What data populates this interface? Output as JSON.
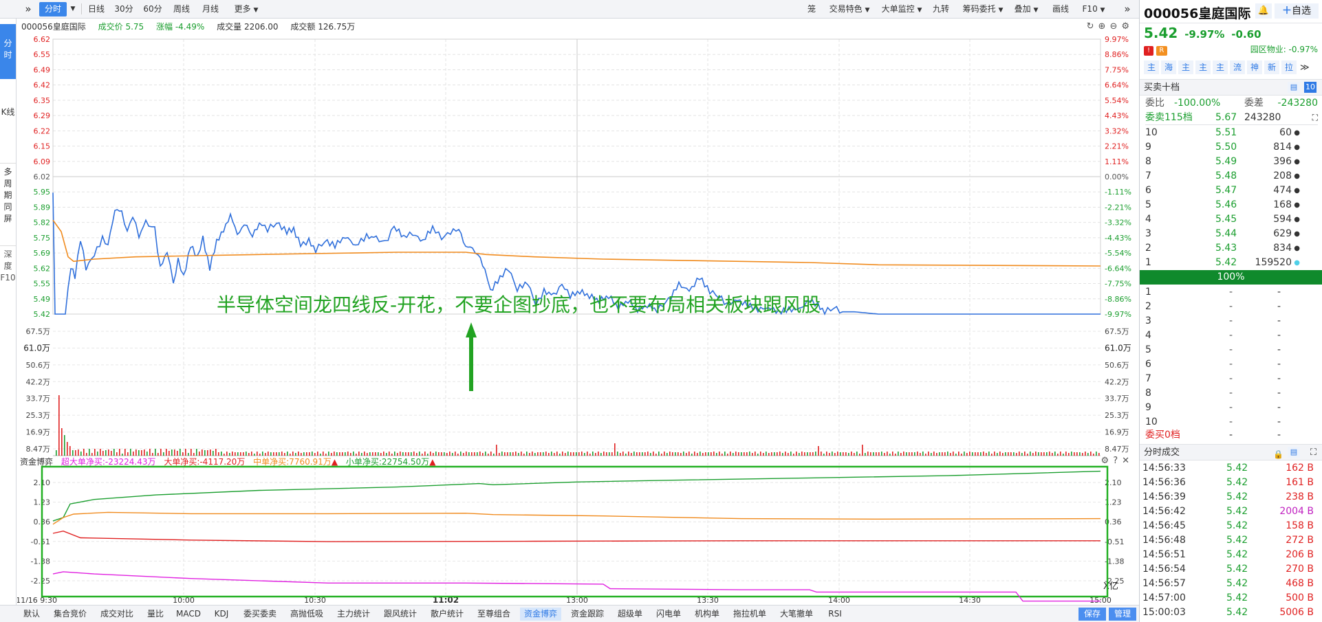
{
  "toolbar": {
    "left_items": [
      "分时",
      "日线",
      "30分",
      "60分",
      "周线",
      "月线",
      "更多"
    ],
    "right_items": [
      "笼",
      "交易特色",
      "大单监控",
      "九转",
      "筹码委托",
      "叠加",
      "画线",
      "F10"
    ]
  },
  "left_tabs": [
    "分时",
    "K线",
    "多周期同屏",
    "深度F10"
  ],
  "info": {
    "code_name": "000056皇庭国际",
    "price": "成交价 5.75",
    "change": "涨幅 -4.49%",
    "volume": "成交量 2206.00",
    "amount": "成交额 126.75万"
  },
  "price_axis": {
    "left": [
      "6.62",
      "6.55",
      "6.49",
      "6.42",
      "6.35",
      "6.29",
      "6.22",
      "6.15",
      "6.09",
      "6.02",
      "5.95",
      "5.89",
      "5.82",
      "5.75",
      "5.69",
      "5.62",
      "5.55",
      "5.49",
      "5.42"
    ],
    "right": [
      "9.97%",
      "8.86%",
      "7.75%",
      "6.64%",
      "5.54%",
      "4.43%",
      "3.32%",
      "2.21%",
      "1.11%",
      "0.00%",
      "-1.11%",
      "-2.21%",
      "-3.32%",
      "-4.43%",
      "-5.54%",
      "-6.64%",
      "-7.75%",
      "-8.86%",
      "-9.97%"
    ]
  },
  "volume_axis": [
    "67.5万",
    "61.0万",
    "50.6万",
    "42.2万",
    "33.7万",
    "25.3万",
    "16.9万",
    "8.47万"
  ],
  "time_axis": [
    "11/16 9:30",
    "10:00",
    "10:30",
    "11:02",
    "13:00",
    "13:30",
    "14:00",
    "14:30",
    "15:00"
  ],
  "annotation": "半导体空间龙四线反-开花，不要企图抄底，也不要布局相关板块跟风股",
  "fund": {
    "title": "资金博弈",
    "super": "超大单净买:-23224.43万",
    "big": "大单净买:-4117.20万",
    "mid": "中单净买:7760.91万",
    "small": "小单净买:22754.50万",
    "axis": [
      "2.10",
      "1.23",
      "0.36",
      "-0.51",
      "-1.38",
      "-2.25"
    ],
    "unit": "X亿"
  },
  "bottom_tabs": [
    "默认",
    "集合竞价",
    "成交对比",
    "量比",
    "MACD",
    "KDJ",
    "委买委卖",
    "高抛低吸",
    "主力统计",
    "跟风统计",
    "散户统计",
    "至尊组合",
    "资金博弈",
    "资金跟踪",
    "超级单",
    "闪电单",
    "机构单",
    "拖拉机单",
    "大笔撤单",
    "RSI"
  ],
  "bottom_active": "资金博弈",
  "bottom_buttons": [
    "保存",
    "管理"
  ],
  "stock": {
    "title": "000056皇庭国际",
    "add_watch": "自选",
    "price": "5.42",
    "pct": "-9.97%",
    "chg": "-0.60",
    "tag": "R",
    "industry": "园区物业: -0.97%",
    "quick_btns": [
      "主",
      "海",
      "主",
      "主",
      "主",
      "流",
      "神",
      "新",
      "拉"
    ]
  },
  "orderbook": {
    "title": "买卖十档",
    "ratio_label": "委比",
    "ratio": "-100.00%",
    "diff_label": "委差",
    "diff": "-243280",
    "sell_total_label": "委卖115档",
    "sell_total_price": "5.67",
    "sell_total_vol": "243280",
    "sells": [
      {
        "lvl": "10",
        "price": "5.51",
        "vol": "60"
      },
      {
        "lvl": "9",
        "price": "5.50",
        "vol": "814"
      },
      {
        "lvl": "8",
        "price": "5.49",
        "vol": "396"
      },
      {
        "lvl": "7",
        "price": "5.48",
        "vol": "208"
      },
      {
        "lvl": "6",
        "price": "5.47",
        "vol": "474"
      },
      {
        "lvl": "5",
        "price": "5.46",
        "vol": "168"
      },
      {
        "lvl": "4",
        "price": "5.45",
        "vol": "594"
      },
      {
        "lvl": "3",
        "price": "5.44",
        "vol": "629"
      },
      {
        "lvl": "2",
        "price": "5.43",
        "vol": "834"
      },
      {
        "lvl": "1",
        "price": "5.42",
        "vol": "159520"
      }
    ],
    "bar_label": "100%",
    "buys": [
      {
        "lvl": "1",
        "price": "-",
        "vol": "-"
      },
      {
        "lvl": "2",
        "price": "-",
        "vol": "-"
      },
      {
        "lvl": "3",
        "price": "-",
        "vol": "-"
      },
      {
        "lvl": "4",
        "price": "-",
        "vol": "-"
      },
      {
        "lvl": "5",
        "price": "-",
        "vol": "-"
      },
      {
        "lvl": "6",
        "price": "-",
        "vol": "-"
      },
      {
        "lvl": "7",
        "price": "-",
        "vol": "-"
      },
      {
        "lvl": "8",
        "price": "-",
        "vol": "-"
      },
      {
        "lvl": "9",
        "price": "-",
        "vol": "-"
      },
      {
        "lvl": "10",
        "price": "-",
        "vol": "-"
      }
    ],
    "buy_total_label": "委买0档",
    "buy_total_price": "-",
    "buy_total_vol": "-"
  },
  "trades": {
    "title": "分时成交",
    "rows": [
      {
        "time": "14:56:33",
        "price": "5.42",
        "vol": "162 B"
      },
      {
        "time": "14:56:36",
        "price": "5.42",
        "vol": "161 B"
      },
      {
        "time": "14:56:39",
        "price": "5.42",
        "vol": "238 B"
      },
      {
        "time": "14:56:42",
        "price": "5.42",
        "vol": "2004 B"
      },
      {
        "time": "14:56:45",
        "price": "5.42",
        "vol": "158 B"
      },
      {
        "time": "14:56:48",
        "price": "5.42",
        "vol": "272 B"
      },
      {
        "time": "14:56:51",
        "price": "5.42",
        "vol": "206 B"
      },
      {
        "time": "14:56:54",
        "price": "5.42",
        "vol": "270 B"
      },
      {
        "time": "14:56:57",
        "price": "5.42",
        "vol": "468 B"
      },
      {
        "time": "14:57:00",
        "price": "5.42",
        "vol": "500 B"
      },
      {
        "time": "15:00:03",
        "price": "5.42",
        "vol": "5006 B"
      }
    ]
  },
  "colors": {
    "accent": "#3a86ea",
    "up": "#e02020",
    "down": "#1a9e2e",
    "price_line": "#2f6fdb",
    "avg_line": "#f08a1c",
    "magenta": "#e020e0",
    "box": "#22b022"
  }
}
